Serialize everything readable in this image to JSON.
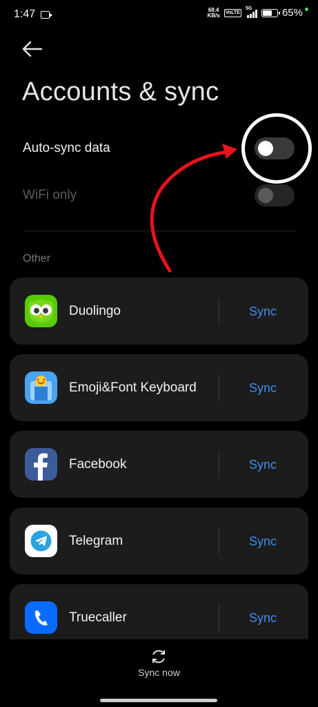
{
  "status_bar": {
    "time": "1:47",
    "net_speed_value": "68.4",
    "net_speed_unit": "KB/s",
    "volte": "VoLTE",
    "network": "5G",
    "battery_percent": "65%",
    "battery_level": 0.65
  },
  "header": {
    "title": "Accounts & sync"
  },
  "settings": {
    "auto_sync_label": "Auto-sync data",
    "auto_sync_on": false,
    "wifi_only_label": "WiFi only",
    "wifi_only_on": false
  },
  "section": {
    "label": "Other"
  },
  "accounts": [
    {
      "name": "Duolingo",
      "sync_label": "Sync",
      "icon": "duolingo-icon"
    },
    {
      "name": "Emoji&Font Keyboard",
      "sync_label": "Sync",
      "icon": "emoji-keyboard-icon"
    },
    {
      "name": "Facebook",
      "sync_label": "Sync",
      "icon": "facebook-icon"
    },
    {
      "name": "Telegram",
      "sync_label": "Sync",
      "icon": "telegram-icon"
    },
    {
      "name": "Truecaller",
      "sync_label": "Sync",
      "icon": "truecaller-icon"
    }
  ],
  "footer": {
    "sync_now_label": "Sync now"
  },
  "colors": {
    "accent_blue": "#3f8ef0",
    "annotation_red": "#e8141c",
    "card_bg": "#1c1c1c"
  }
}
